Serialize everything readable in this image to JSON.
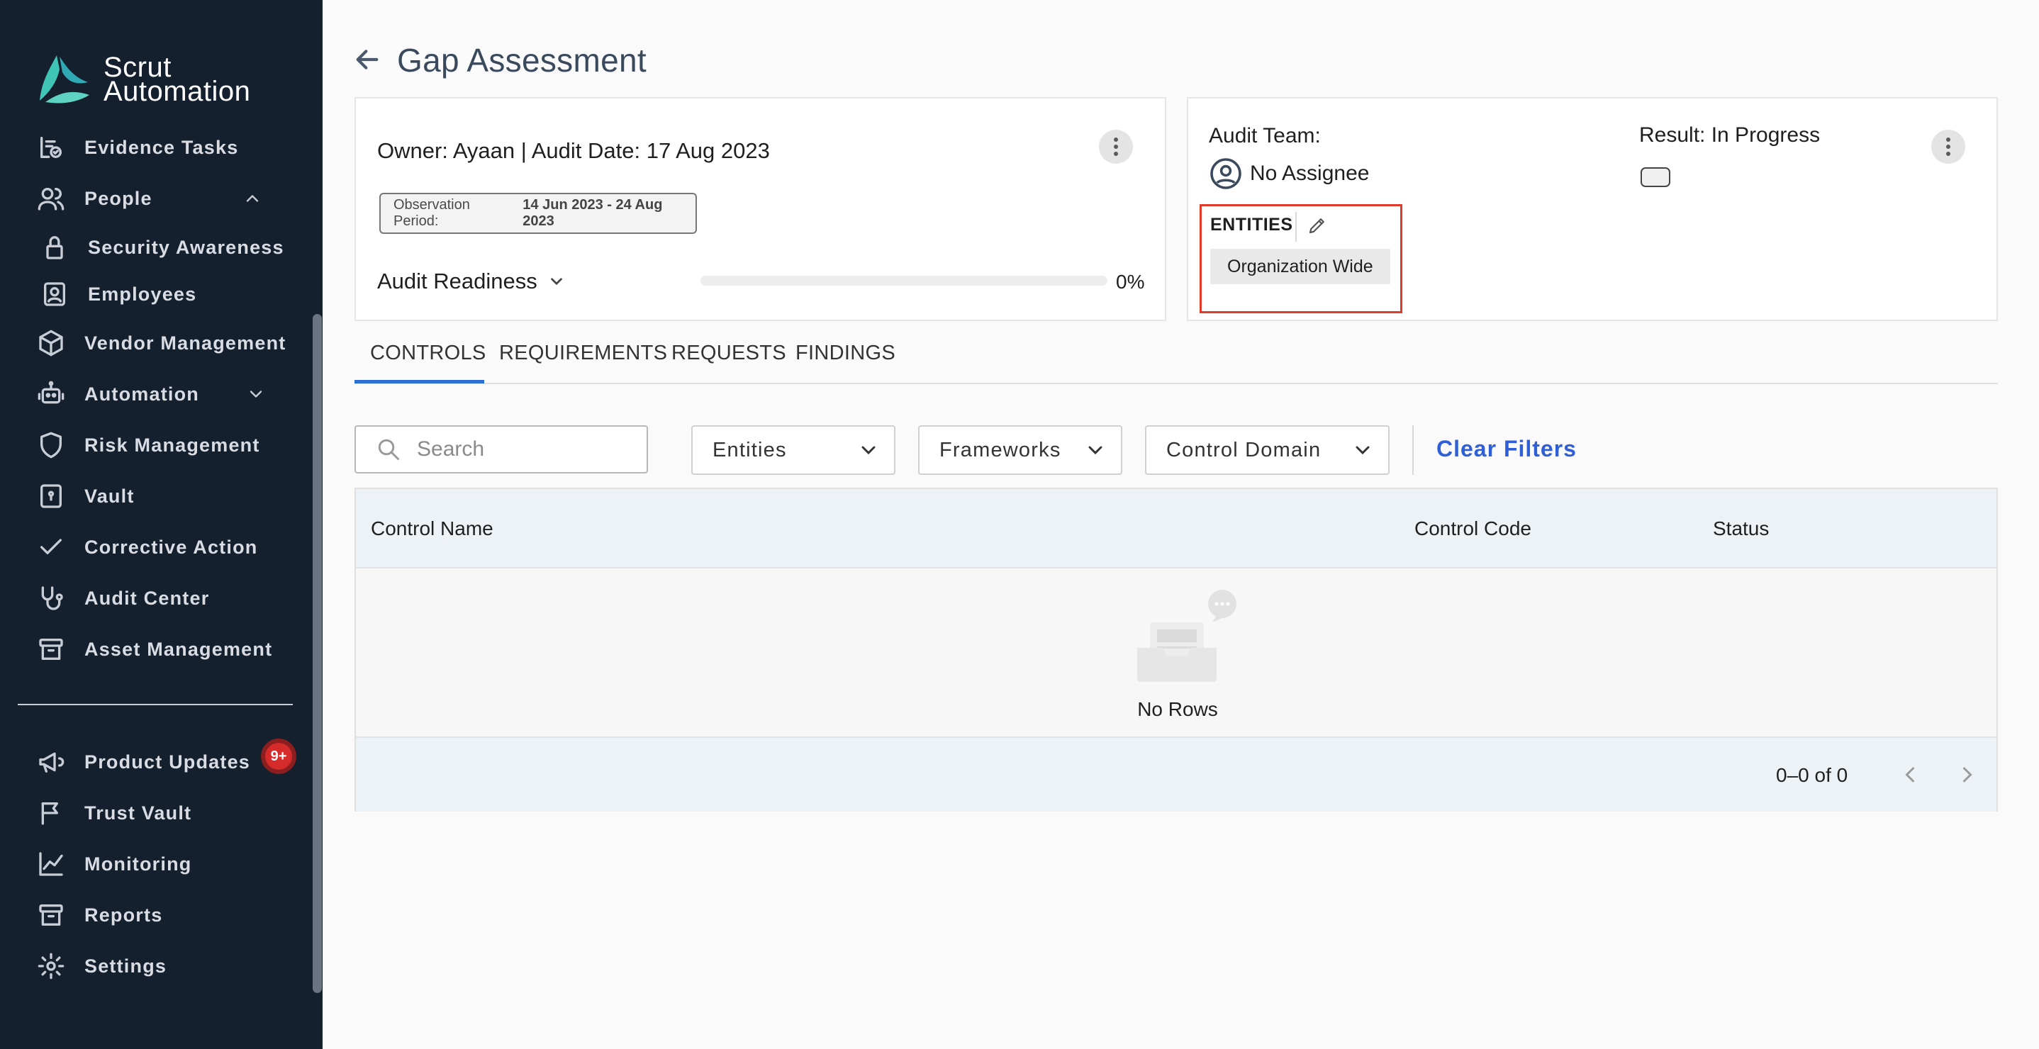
{
  "brand": {
    "line1": "Scrut",
    "line2": "Automation"
  },
  "sidebar": {
    "items": [
      {
        "label": "Evidence Tasks",
        "icon": "evidence-tasks-icon"
      },
      {
        "label": "People",
        "icon": "people-icon",
        "expanded": true
      },
      {
        "label": "Security Awareness",
        "icon": "lock-icon"
      },
      {
        "label": "Employees",
        "icon": "employee-badge-icon"
      },
      {
        "label": "Vendor Management",
        "icon": "cube-icon"
      },
      {
        "label": "Automation",
        "icon": "robot-icon",
        "expanded": false
      },
      {
        "label": "Risk Management",
        "icon": "shield-icon"
      },
      {
        "label": "Vault",
        "icon": "vault-icon"
      },
      {
        "label": "Corrective Action",
        "icon": "check-icon"
      },
      {
        "label": "Audit Center",
        "icon": "stethoscope-icon"
      },
      {
        "label": "Asset Management",
        "icon": "archive-icon"
      },
      {
        "label": "Product Updates",
        "icon": "megaphone-icon"
      },
      {
        "label": "Trust Vault",
        "icon": "flag-icon"
      },
      {
        "label": "Monitoring",
        "icon": "chart-line-icon"
      },
      {
        "label": "Reports",
        "icon": "archive-icon"
      },
      {
        "label": "Settings",
        "icon": "gear-icon"
      }
    ],
    "product_updates_badge": "9+"
  },
  "page": {
    "title": "Gap Assessment"
  },
  "audit_card": {
    "owner_line": "Owner: Ayaan | Audit Date: 17 Aug 2023",
    "observation_label": "Observation Period:",
    "observation_value": "14 Jun 2023 - 24 Aug 2023",
    "readiness_label": "Audit Readiness",
    "readiness_value": 0,
    "readiness_percent": "0%"
  },
  "team_card": {
    "team_label": "Audit Team:",
    "assignee": "No Assignee",
    "result": "Result: In Progress",
    "entities_label": "ENTITIES",
    "entity_chip": "Organization Wide"
  },
  "tabs": [
    {
      "label": "CONTROLS",
      "active": true
    },
    {
      "label": "REQUIREMENTS",
      "active": false
    },
    {
      "label": "REQUESTS",
      "active": false
    },
    {
      "label": "FINDINGS",
      "active": false
    }
  ],
  "filters": {
    "search_placeholder": "Search",
    "entities": "Entities",
    "frameworks": "Frameworks",
    "control_domain": "Control Domain",
    "clear": "Clear Filters"
  },
  "table": {
    "columns": [
      "Control Name",
      "Control Code",
      "Status"
    ],
    "empty_text": "No Rows",
    "pagination": "0–0 of 0"
  },
  "colors": {
    "sidebar_bg": "#14202e",
    "accent": "#2e5fd6",
    "highlight": "#e03a2b"
  }
}
